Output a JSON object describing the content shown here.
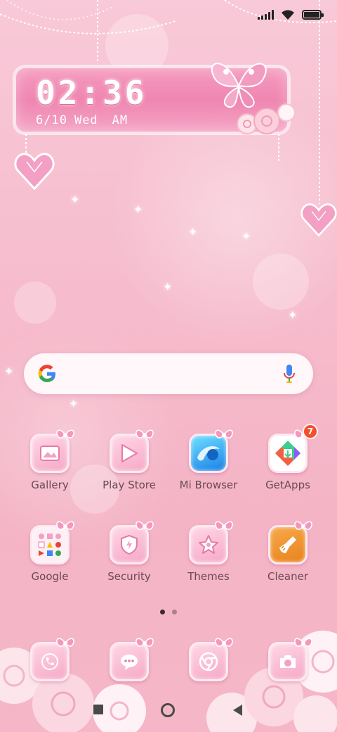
{
  "status_bar": {
    "signal_icon": "signal-bars-icon",
    "wifi_icon": "wifi-icon",
    "battery_icon": "battery-icon",
    "battery_level_percent": 100
  },
  "clock": {
    "time": "02:36",
    "date": "6/10",
    "weekday": "Wed",
    "period": "AM"
  },
  "search": {
    "logo_icon": "google-g-icon",
    "mic_icon": "microphone-icon"
  },
  "apps": {
    "row1": [
      {
        "label": "Gallery",
        "icon": "gallery-icon"
      },
      {
        "label": "Play Store",
        "icon": "play-store-icon"
      },
      {
        "label": "Mi Browser",
        "icon": "mi-browser-icon"
      },
      {
        "label": "GetApps",
        "icon": "getapps-icon",
        "badge": "7"
      }
    ],
    "row2": [
      {
        "label": "Google",
        "icon": "google-folder-icon"
      },
      {
        "label": "Security",
        "icon": "security-icon"
      },
      {
        "label": "Themes",
        "icon": "themes-icon"
      },
      {
        "label": "Cleaner",
        "icon": "cleaner-icon"
      }
    ]
  },
  "dock": [
    {
      "icon": "phone-icon"
    },
    {
      "icon": "messages-icon"
    },
    {
      "icon": "chrome-icon"
    },
    {
      "icon": "camera-icon"
    }
  ],
  "page_indicator": {
    "pages": 2,
    "current": 1
  },
  "navbar": {
    "recents_icon": "recents-square-icon",
    "home_icon": "home-circle-icon",
    "back_icon": "back-triangle-icon"
  },
  "colors": {
    "accent_pink": "#ef86b1",
    "badge_red": "#f0502c",
    "label_text": "#6b4a55"
  }
}
